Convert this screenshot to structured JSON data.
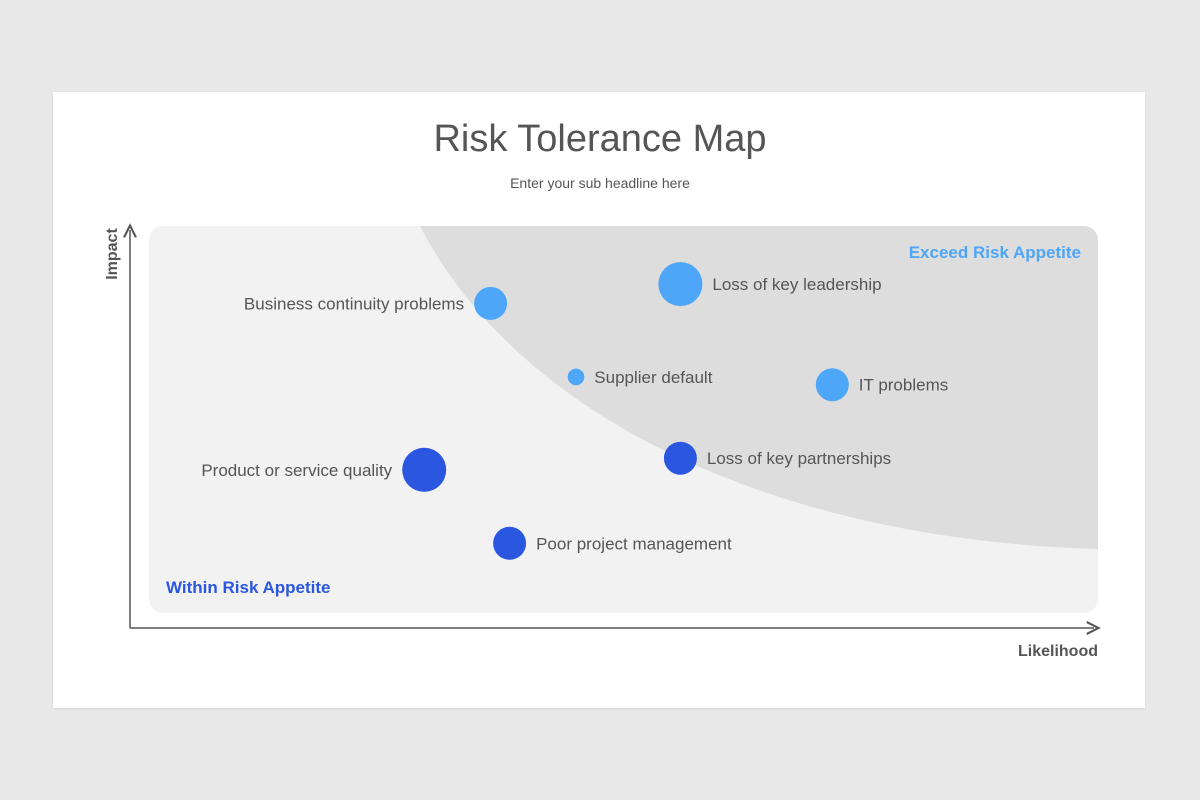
{
  "slide": {
    "title": "Risk Tolerance Map",
    "subtitle": "Enter your sub headline here"
  },
  "chart_data": {
    "type": "scatter",
    "title": "Risk Tolerance Map",
    "subtitle": "Enter your sub headline here",
    "xlabel": "Likelihood",
    "ylabel": "Impact",
    "xlim": [
      0,
      10
    ],
    "ylim": [
      0,
      10
    ],
    "zones": [
      {
        "name": "Exceed Risk Appetite",
        "color": "#4da6f7",
        "region": "upper-right"
      },
      {
        "name": "Within Risk Appetite",
        "color": "#2a56e0",
        "region": "lower-left"
      }
    ],
    "colors": {
      "exceed": "#4da6f7",
      "within": "#2a56e0",
      "plot_bg": "#f2f2f3",
      "exceed_bg": "#dddddd"
    },
    "points": [
      {
        "label": "Business continuity problems",
        "x": 3.6,
        "y": 8.0,
        "size": 3,
        "zone": "exceed",
        "label_side": "left"
      },
      {
        "label": "Loss of key leadership",
        "x": 5.6,
        "y": 8.5,
        "size": 4,
        "zone": "exceed",
        "label_side": "right"
      },
      {
        "label": "Supplier default",
        "x": 4.5,
        "y": 6.1,
        "size": 1.5,
        "zone": "exceed",
        "label_side": "right"
      },
      {
        "label": "IT problems",
        "x": 7.2,
        "y": 5.9,
        "size": 3,
        "zone": "exceed",
        "label_side": "right"
      },
      {
        "label": "Product or service quality",
        "x": 2.9,
        "y": 3.7,
        "size": 4,
        "zone": "within",
        "label_side": "left"
      },
      {
        "label": "Loss of key partnerships",
        "x": 5.6,
        "y": 4.0,
        "size": 3,
        "zone": "within",
        "label_side": "right"
      },
      {
        "label": "Poor project management",
        "x": 3.8,
        "y": 1.8,
        "size": 3,
        "zone": "within",
        "label_side": "right"
      }
    ]
  }
}
